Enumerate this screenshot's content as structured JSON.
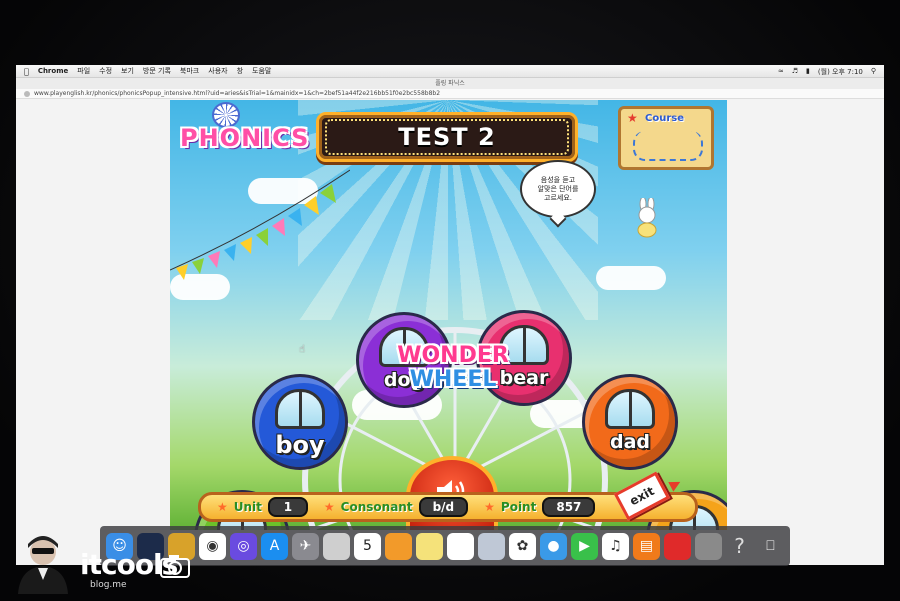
{
  "menubar": {
    "apple_icon": "apple-icon",
    "app": "Chrome",
    "items": [
      "파일",
      "수정",
      "보기",
      "방문 기록",
      "북마크",
      "사용자",
      "창",
      "도움말"
    ],
    "clock": "(월) 오후 7:10"
  },
  "window": {
    "title": "플링 파닉스"
  },
  "url": "www.playenglish.kr/phonics/phonicsPopup_intensive.html?uid=aries&isTrial=1&mainidx=1&ch=2bef51a44f2e216bb51f0e2bc558b8b2",
  "game": {
    "logo": "PHONICS",
    "test_title": "TEST 2",
    "course_label": "Course",
    "speech": "음성을 듣고\n알맞은 단어를\n고르세요.",
    "center_logo_1": "WONDER",
    "center_logo_2": "WHEEL",
    "gondolas": [
      {
        "word": "dog",
        "color": "#8b2fd6"
      },
      {
        "word": "bear",
        "color": "#e8306f"
      },
      {
        "word": "boy",
        "color": "#2459d8"
      },
      {
        "word": "dad",
        "color": "#f26a1a"
      },
      {
        "word": "",
        "color": "#6cc22a"
      },
      {
        "word": "",
        "color": "#f5a31a"
      }
    ],
    "hud": {
      "unit_label": "Unit",
      "unit_value": "1",
      "consonant_label": "Consonant",
      "consonant_value": "b/d",
      "point_label": "Point",
      "point_value": "857"
    },
    "exit_label": "exit",
    "sound_icon": "speaker-icon"
  },
  "dock": {
    "items": [
      "finder-icon",
      "xcode-icon",
      "tooltip-icon",
      "chrome-icon",
      "siri-icon",
      "app-store-icon",
      "launchpad-icon",
      "photos-viewer-icon",
      "calendar-icon",
      "pages-icon",
      "notes-icon",
      "reminders-icon",
      "preview-icon",
      "photos-icon",
      "messages-icon",
      "facetime-icon",
      "music-icon",
      "books-icon",
      "roblox-icon",
      "system-preferences-icon",
      "help-icon",
      "trash-icon"
    ],
    "calendar_day": "5",
    "help_glyph": "?"
  },
  "watermark": {
    "name": "itcools",
    "sub": "blog.me"
  }
}
